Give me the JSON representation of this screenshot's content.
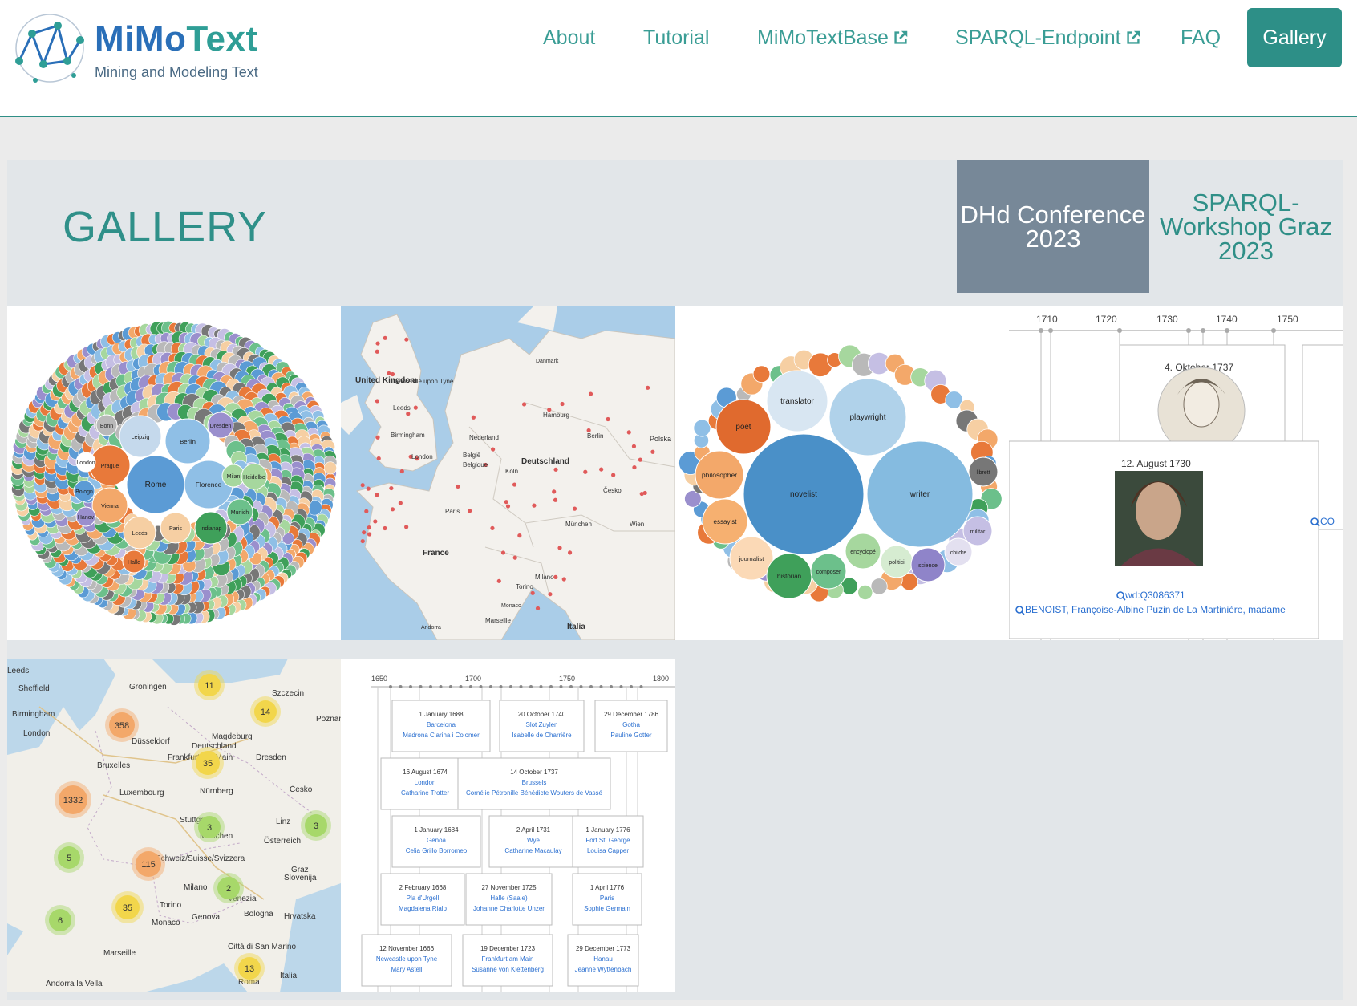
{
  "brand": {
    "name_a": "MiMo",
    "name_b": "Text",
    "tagline": "Mining and Modeling Text"
  },
  "nav": {
    "about": "About",
    "tutorial": "Tutorial",
    "mimotextbase": "MiMoTextBase",
    "sparql": "SPARQL-Endpoint",
    "faq": "FAQ",
    "gallery": "Gallery"
  },
  "page": {
    "title": "GALLERY",
    "tab_dhd": "DHd Conference 2023",
    "tab_sparql": "SPARQL-Workshop Graz 2023"
  },
  "colors": {
    "accent": "#2d8f87",
    "tab_active": "#778898",
    "band": "#e2e6e9"
  },
  "tiles": {
    "places_bubbles": {
      "labels": [
        "Rome",
        "Florence",
        "Berlin",
        "Leipzig",
        "Prague",
        "Vienna",
        "Leeds",
        "Paris",
        "Indianap",
        "Munich",
        "Milan",
        "Dresden",
        "Bonn",
        "Heidelbe",
        "Halle",
        "London",
        "Bologn",
        "Hanov"
      ]
    },
    "europe_map": {
      "labels": [
        "United Kingdom",
        "Newcastle upon Tyne",
        "Leeds",
        "Birmingham",
        "London",
        "Nederland",
        "België",
        "Belgique",
        "Deutschland",
        "Hamburg",
        "Berlin",
        "Köln",
        "Paris",
        "France",
        "Česko",
        "München",
        "Wien",
        "Milano",
        "Torino",
        "Italia",
        "Marseille",
        "Polska",
        "Danmark",
        "Monaco",
        "Andorra"
      ]
    },
    "occupation_bubbles": {
      "labels": [
        "novelist",
        "writer",
        "playwright",
        "translator",
        "poet",
        "philosopher",
        "essayist",
        "journalist",
        "historian",
        "composer",
        "encyclopé",
        "politici",
        "science",
        "librett",
        "militar",
        "childre"
      ]
    },
    "timeline_portraits": {
      "years": [
        "1710",
        "1720",
        "1730",
        "1740",
        "1750"
      ],
      "card1_date": "4. Oktober 1737",
      "card2_date": "12. August 1730",
      "card2_qid": "wd:Q3086371",
      "card2_name": "BENOIST, Françoise-Albine Puzin de La Martinière, madame"
    },
    "cluster_map": {
      "places": [
        "Leeds",
        "Sheffield",
        "Birmingham",
        "London",
        "Groningen",
        "Szczecin",
        "Düsseldorf",
        "Deutschland",
        "Dresden",
        "Bruxelles",
        "Frankfurt am Main",
        "Luxembourg",
        "Nürnberg",
        "Česko",
        "Stuttgart",
        "München",
        "Linz",
        "Österreich",
        "Schweiz/Suisse/Svizzera",
        "Milano",
        "Venezia",
        "Torino",
        "Genova",
        "Bologna",
        "Monaco",
        "Marseille",
        "Slovenija",
        "Hrvatska",
        "Città di San Marino",
        "Roma",
        "Italia",
        "Andorra la Vella",
        "Magdeburg",
        "Poznań",
        "Graz"
      ],
      "clusters": [
        "11",
        "14",
        "358",
        "35",
        "1332",
        "3",
        "3",
        "5",
        "115",
        "2",
        "35",
        "6",
        "13"
      ]
    },
    "timeline_cards": {
      "years": [
        "1650",
        "1700",
        "1750",
        "1800"
      ],
      "cards": [
        [
          "1 January 1688",
          "Barcelona",
          "Madrona Clarina i Colomer"
        ],
        [
          "20 October 1740",
          "Slot Zuylen",
          "Isabelle de Charrière"
        ],
        [
          "29 December 1786",
          "Gotha",
          "Pauline Gotter"
        ],
        [
          "16 August 1674",
          "London",
          "Catharine Trotter"
        ],
        [
          "14 October 1737",
          "Brussels",
          "Cornélie Pétronille Bénédicte Wouters de Vassé"
        ],
        [
          "1 January 1684",
          "Genoa",
          "Celia Grillo Borromeo"
        ],
        [
          "2 April 1731",
          "Wye",
          "Catharine Macaulay"
        ],
        [
          "1 January 1776",
          "Fort St. George",
          "Louisa Capper"
        ],
        [
          "2 February 1668",
          "Pla d'Urgell",
          "Magdalena Rialp"
        ],
        [
          "27 November 1725",
          "Halle (Saale)",
          "Johanne Charlotte Unzer"
        ],
        [
          "1 April 1776",
          "Paris",
          "Sophie Germain"
        ],
        [
          "12 November 1666",
          "Newcastle upon Tyne",
          "Mary Astell"
        ],
        [
          "19 December 1723",
          "Frankfurt am Main",
          "Susanne von Klettenberg"
        ],
        [
          "29 December 1773",
          "Hanau",
          "Jeanne Wyttenbach"
        ]
      ]
    }
  }
}
